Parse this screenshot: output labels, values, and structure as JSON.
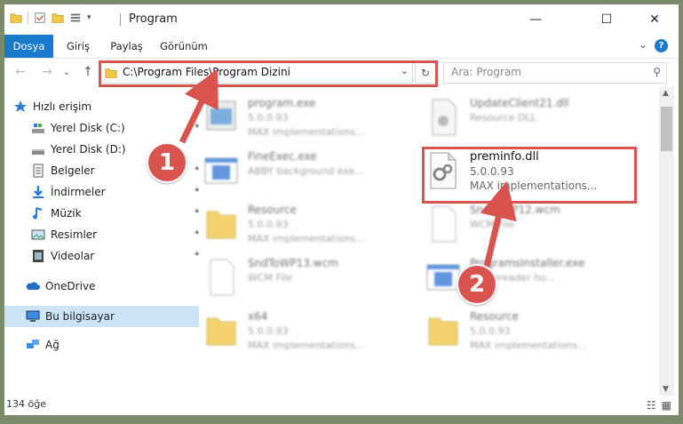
{
  "window": {
    "title": "Program",
    "minimize": "—",
    "maximize": "☐",
    "close": "✕"
  },
  "ribbon": {
    "tabs": [
      {
        "label": "Dosya",
        "active": true
      },
      {
        "label": "Giriş",
        "active": false
      },
      {
        "label": "Paylaş",
        "active": false
      },
      {
        "label": "Görünüm",
        "active": false
      }
    ],
    "expand": "⌄",
    "help": "?"
  },
  "navigation": {
    "back": "←",
    "forward": "→",
    "recent": "⌄",
    "up": "↑",
    "address": "C:\\Program Files\\Program Dizini",
    "address_dropdown": "⌄",
    "refresh": "↻",
    "search_placeholder": "Ara: Program",
    "search_icon": "⚲"
  },
  "sidebar": {
    "items": [
      {
        "label": "Hızlı erişim",
        "icon": "star-icon",
        "pinned": false,
        "selected": false
      },
      {
        "label": "Yerel Disk (C:)",
        "icon": "drive-icon",
        "pinned": true,
        "selected": false
      },
      {
        "label": "Yerel Disk (D:)",
        "icon": "drive-icon",
        "pinned": true,
        "selected": false
      },
      {
        "label": "Belgeler",
        "icon": "documents-icon",
        "pinned": true,
        "selected": false
      },
      {
        "label": "İndirmeler",
        "icon": "download-icon",
        "pinned": true,
        "selected": false
      },
      {
        "label": "Müzik",
        "icon": "music-icon",
        "pinned": true,
        "selected": false
      },
      {
        "label": "Resimler",
        "icon": "pictures-icon",
        "pinned": true,
        "selected": false
      },
      {
        "label": "Videolar",
        "icon": "videos-icon",
        "pinned": true,
        "selected": false
      },
      {
        "label": "OneDrive",
        "icon": "cloud-icon",
        "pinned": false,
        "selected": false
      },
      {
        "label": "Bu bilgisayar",
        "icon": "computer-icon",
        "pinned": false,
        "selected": true
      },
      {
        "label": "Ağ",
        "icon": "network-icon",
        "pinned": false,
        "selected": false
      }
    ],
    "pin_glyph": "📌"
  },
  "files": [
    {
      "name": "program.exe",
      "version": "5.0.0.93",
      "desc": "MAX implementations...",
      "icon": "exe-icon",
      "focus": false
    },
    {
      "name": "UpdateClient21.dll",
      "version": "Resource DLL",
      "desc": "",
      "icon": "dll-icon",
      "focus": false
    },
    {
      "name": "FineExec.exe",
      "version": "ABBY background exe...",
      "desc": "",
      "icon": "app-window-icon",
      "focus": false
    },
    {
      "name": "preminfo.dll",
      "version": "5.0.0.93",
      "desc": "MAX implementations...",
      "icon": "dll-gear-icon",
      "focus": true
    },
    {
      "name": "Resource",
      "version": "5.0.0.93",
      "desc": "MAX implementations...",
      "icon": "folder-icon",
      "focus": false
    },
    {
      "name": "SndToWP12.wcm",
      "version": "WCM File",
      "desc": "",
      "icon": "blank-file-icon",
      "focus": false
    },
    {
      "name": "SndToWP13.wcm",
      "version": "WCM File",
      "desc": "",
      "icon": "blank-file-icon",
      "focus": false
    },
    {
      "name": "ProgramsInstaller.exe",
      "version": "Y Finereader ho...",
      "desc": "",
      "icon": "app-window-icon",
      "focus": false
    },
    {
      "name": "x64",
      "version": "5.0.0.93",
      "desc": "MAX implementations...",
      "icon": "folder-icon",
      "focus": false
    },
    {
      "name": "Resource",
      "version": "5.0.0.93",
      "desc": "MAX implementations...",
      "icon": "folder-icon",
      "focus": false
    }
  ],
  "status": {
    "count": "134 öğe",
    "details_view": "☷",
    "tiles_view": "▦"
  },
  "annotations": {
    "callout_1": "1",
    "callout_2": "2",
    "color": "#d9534f"
  },
  "colors": {
    "accent": "#1979ca",
    "selection": "#cce4f7",
    "highlight": "#d9534f"
  }
}
